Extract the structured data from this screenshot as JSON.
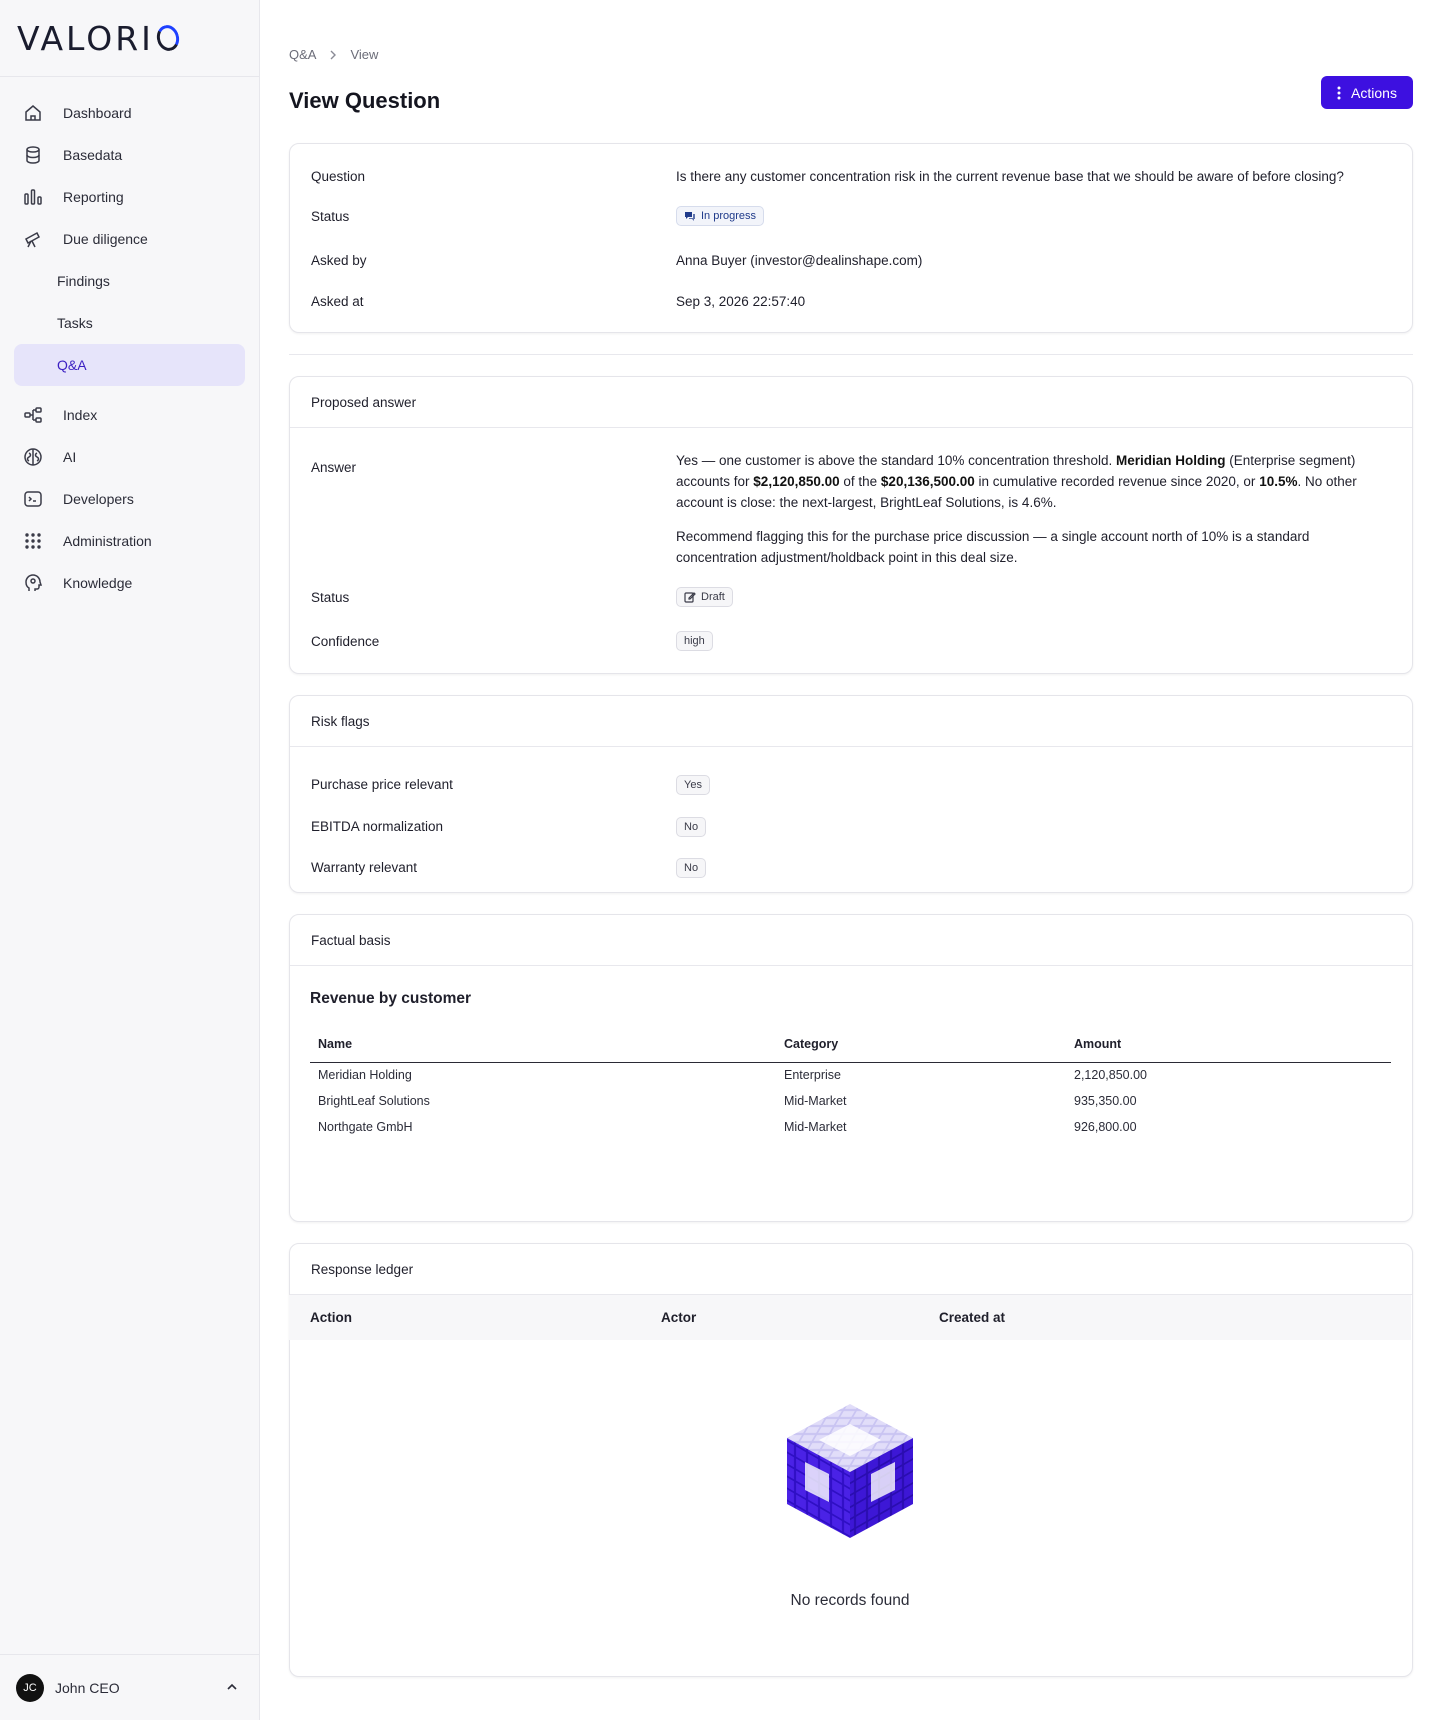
{
  "brand": {
    "name": "VALORI",
    "accent": "#3d10e0",
    "logo_accent": "#1e40ff"
  },
  "sidebar": {
    "items": [
      {
        "label": "Dashboard",
        "icon": "home-icon"
      },
      {
        "label": "Basedata",
        "icon": "database-icon"
      },
      {
        "label": "Reporting",
        "icon": "bar-chart-icon"
      },
      {
        "label": "Due diligence",
        "icon": "telescope-icon"
      },
      {
        "label": "Findings",
        "icon": ""
      },
      {
        "label": "Tasks",
        "icon": ""
      },
      {
        "label": "Q&A",
        "icon": "",
        "active": true
      },
      {
        "label": "Index",
        "icon": "index-icon"
      },
      {
        "label": "AI",
        "icon": "brain-icon"
      },
      {
        "label": "Developers",
        "icon": "terminal-icon"
      },
      {
        "label": "Administration",
        "icon": "grid-icon"
      },
      {
        "label": "Knowledge",
        "icon": "head-icon"
      }
    ],
    "user": {
      "initials": "JC",
      "name": "John CEO"
    }
  },
  "breadcrumb": {
    "root": "Q&A",
    "current": "View"
  },
  "page": {
    "title": "View Question",
    "actions_label": "Actions"
  },
  "question_card": {
    "question_label": "Question",
    "question_value": "Is there any customer concentration risk in the current revenue base that we should be aware of before closing?",
    "status_label": "Status",
    "status_value": "In progress",
    "asked_by_label": "Asked by",
    "asked_by_value": "Anna Buyer (investor@dealinshape.com)",
    "asked_at_label": "Asked at",
    "asked_at_value": "Sep 3, 2026 22:57:40"
  },
  "proposed_answer": {
    "title": "Proposed answer",
    "answer_label": "Answer",
    "answer_parts": {
      "p1a": "Yes — one customer is above the standard 10% concentration threshold. ",
      "p1b": "Meridian Holding",
      "p1c": " (Enterprise segment) accounts for ",
      "p1d": "$2,120,850.00",
      "p1e": " of the ",
      "p1f": "$20,136,500.00",
      "p1g": " in cumulative recorded revenue since 2020, or ",
      "p1h": "10.5%",
      "p1i": ". No other account is close: the next-largest, BrightLeaf Solutions, is 4.6%.",
      "p2": "Recommend flagging this for the purchase price discussion — a single account north of 10% is a standard concentration adjustment/holdback point in this deal size."
    },
    "status_label": "Status",
    "status_value": "Draft",
    "confidence_label": "Confidence",
    "confidence_value": "high"
  },
  "risk_flags": {
    "title": "Risk flags",
    "items": [
      {
        "label": "Purchase price relevant",
        "value": "Yes"
      },
      {
        "label": "EBITDA normalization",
        "value": "No"
      },
      {
        "label": "Warranty relevant",
        "value": "No"
      }
    ]
  },
  "factual_basis": {
    "title": "Factual basis",
    "subtitle": "Revenue by customer",
    "columns": [
      "Name",
      "Category",
      "Amount"
    ],
    "rows": [
      [
        "Meridian Holding",
        "Enterprise",
        "2,120,850.00"
      ],
      [
        "BrightLeaf Solutions",
        "Mid-Market",
        "935,350.00"
      ],
      [
        "Northgate GmbH",
        "Mid-Market",
        "926,800.00"
      ]
    ]
  },
  "ledger": {
    "title": "Response ledger",
    "columns": [
      "Action",
      "Actor",
      "Created at"
    ],
    "empty_text": "No records found"
  }
}
